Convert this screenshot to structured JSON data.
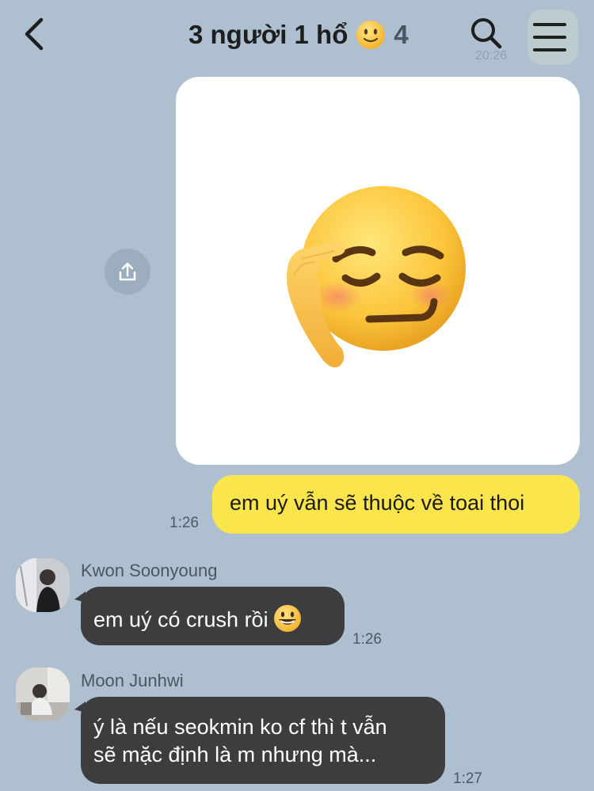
{
  "header": {
    "title": "3 người 1 hổ",
    "member_count": "4",
    "title_emoji": "slightly-smiling-face-icon",
    "back_icon": "chevron-left-icon",
    "search_icon": "search-icon",
    "menu_icon": "hamburger-menu-icon",
    "ghost_time": "20:26"
  },
  "messages": [
    {
      "from": "me",
      "type": "image",
      "content": "relieved-smirk-emoji-sticker",
      "share_icon": "share-icon"
    },
    {
      "from": "me",
      "type": "text",
      "text": "em uý vẫn sẽ thuộc về toai thoi",
      "time": "1:26"
    },
    {
      "from": "Kwon Soonyoung",
      "type": "text",
      "text": "em uý có crush rồi",
      "emoji": "grinning-face-icon",
      "time": "1:26"
    },
    {
      "from": "Moon Junhwi",
      "type": "text",
      "lines": [
        "ý là nếu seokmin ko cf thì t vẫn",
        "sẽ mặc định là m nhưng mà..."
      ],
      "time": "1:27"
    }
  ],
  "colors": {
    "background": "#aebfd0",
    "my_bubble": "#fbe54d",
    "other_bubble": "#3d3d40"
  }
}
